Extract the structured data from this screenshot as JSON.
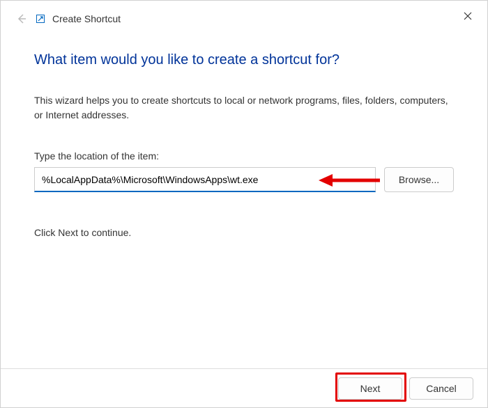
{
  "header": {
    "title": "Create Shortcut"
  },
  "main": {
    "heading": "What item would you like to create a shortcut for?",
    "description": "This wizard helps you to create shortcuts to local or network programs, files, folders, computers, or Internet addresses.",
    "field_label": "Type the location of the item:",
    "location_value": "%LocalAppData%\\Microsoft\\WindowsApps\\wt.exe",
    "browse_label": "Browse...",
    "continue_text": "Click Next to continue."
  },
  "footer": {
    "next_label": "Next",
    "cancel_label": "Cancel"
  },
  "colors": {
    "heading": "#003399",
    "accent": "#0067c0",
    "annotation": "#e30000"
  }
}
